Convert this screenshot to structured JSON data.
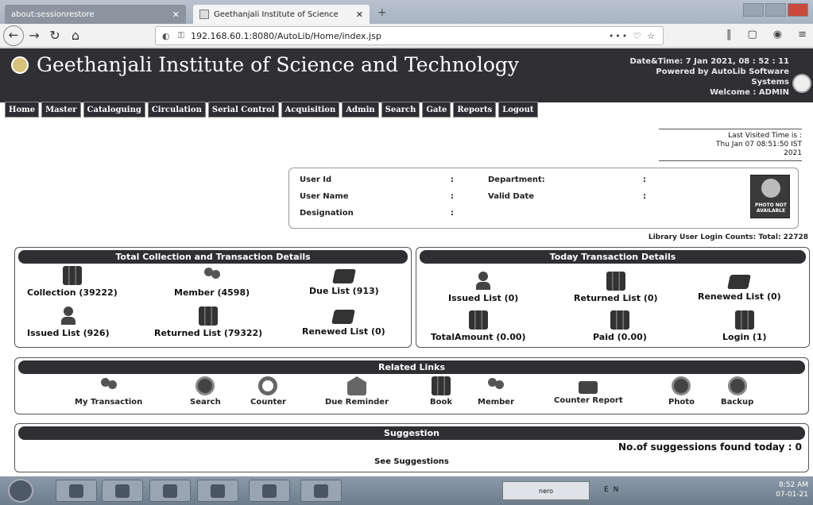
{
  "browser": {
    "tabs": [
      {
        "label": "about:sessionrestore",
        "active": false
      },
      {
        "label": "Geethanjali Institute of Science",
        "active": true
      }
    ],
    "url": "192.168.60.1:8080/AutoLib/Home/index.jsp",
    "url_actions": "••• ♡ ☆"
  },
  "header": {
    "title": "Geethanjali Institute of Science and Technology",
    "datetime": "Date&Time:  7 Jan 2021, 08 : 52 : 11",
    "powered_line1": "Powered by AutoLib Software",
    "powered_line2": "Systems",
    "welcome": "Welcome   :  ADMIN"
  },
  "menu": [
    "Home",
    "Master",
    "Cataloguing",
    "Circulation",
    "Serial Control",
    "Acquisition",
    "Admin",
    "Search",
    "Gate",
    "Reports",
    "Logout"
  ],
  "last_visit": {
    "line1": "Last Visited Time is :",
    "line2": "Thu Jan 07 08:51:50 IST",
    "line3": "2021"
  },
  "user": {
    "user_id_label": "User Id",
    "user_name_label": "User Name",
    "designation_label": "Designation",
    "department_label": "Department:",
    "valid_date_label": "Valid Date",
    "colon": ":",
    "photo_text": "PHOTO NOT AVAILABLE"
  },
  "login_counts": "Library User Login Counts: Total: 22728",
  "total_panel": {
    "title": "Total Collection and Transaction Details",
    "stats": [
      {
        "label": "Collection (39222)",
        "icon": "books-icon"
      },
      {
        "label": "Member (4598)",
        "icon": "members-icon"
      },
      {
        "label": "Due List (913)",
        "icon": "due-book-icon"
      },
      {
        "label": "Issued List (926)",
        "icon": "issued-person-icon"
      },
      {
        "label": "Returned List (79322)",
        "icon": "returned-book-icon"
      },
      {
        "label": "Renewed List (0)",
        "icon": "renewed-book-icon"
      }
    ]
  },
  "today_panel": {
    "title": "Today Transaction Details",
    "stats": [
      {
        "label": "Issued List (0)",
        "icon": "issued-person-icon"
      },
      {
        "label": "Returned List (0)",
        "icon": "returned-book-icon"
      },
      {
        "label": "Renewed List (0)",
        "icon": "renewed-book-icon"
      },
      {
        "label": "TotalAmount (0.00)",
        "icon": "books-icon"
      },
      {
        "label": "Paid (0.00)",
        "icon": "books-icon"
      },
      {
        "label": "Login (1)",
        "icon": "books-icon"
      }
    ]
  },
  "related_links": {
    "title": "Related Links",
    "items": [
      "My Transaction",
      "Search",
      "Counter",
      "Due Reminder",
      "Book",
      "Member",
      "Counter Report",
      "Photo",
      "Backup"
    ]
  },
  "suggestion": {
    "title": "Suggestion",
    "count_text": "No.of suggessions found today : 0",
    "link": "See Suggestions"
  },
  "taskbar": {
    "nero": "nero",
    "tray": "EN",
    "time": "8:52 AM",
    "date": "07-01-21"
  }
}
